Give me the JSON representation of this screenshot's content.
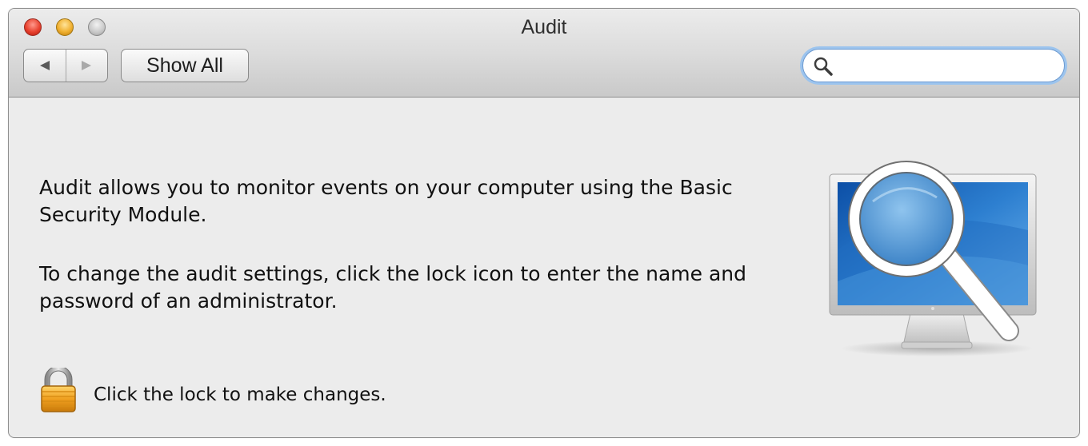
{
  "window": {
    "title": "Audit"
  },
  "toolbar": {
    "back_icon": "triangle-left",
    "forward_icon": "triangle-right",
    "show_all_label": "Show All",
    "search": {
      "value": "",
      "placeholder": ""
    }
  },
  "content": {
    "description": "Audit allows you to monitor events on your computer using the Basic Security Module.",
    "instructions": "To change the audit settings, click the lock icon to enter the name and password of an administrator.",
    "lock_label": "Click the lock to make changes."
  },
  "colors": {
    "window_bg": "#ececec",
    "search_focus": "#9cc4ee",
    "lock_gold": "#f0a020",
    "screen_blue": "#2d7fd0"
  }
}
